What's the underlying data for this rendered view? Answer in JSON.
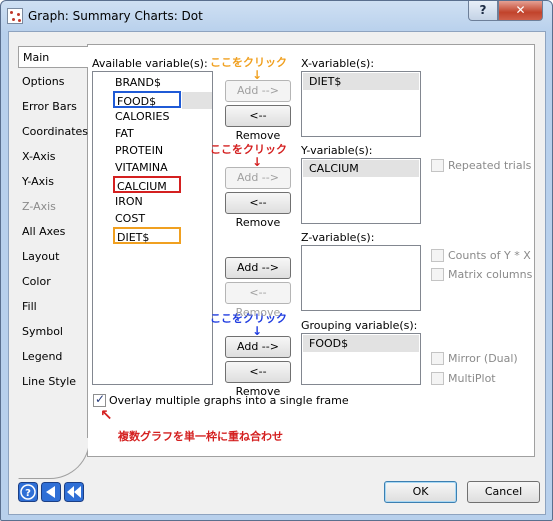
{
  "window": {
    "title": "Graph: Summary Charts: Dot",
    "help_label": "?",
    "close_label": "✕"
  },
  "tabs": [
    {
      "label": "Main",
      "state": "active"
    },
    {
      "label": "Options",
      "state": "normal"
    },
    {
      "label": "Error Bars",
      "state": "normal"
    },
    {
      "label": "Coordinates",
      "state": "normal"
    },
    {
      "label": "X-Axis",
      "state": "normal"
    },
    {
      "label": "Y-Axis",
      "state": "normal"
    },
    {
      "label": "Z-Axis",
      "state": "disabled"
    },
    {
      "label": "All Axes",
      "state": "normal"
    },
    {
      "label": "Layout",
      "state": "normal"
    },
    {
      "label": "Color",
      "state": "normal"
    },
    {
      "label": "Fill",
      "state": "normal"
    },
    {
      "label": "Symbol",
      "state": "normal"
    },
    {
      "label": "Legend",
      "state": "normal"
    },
    {
      "label": "Line Style",
      "state": "normal"
    }
  ],
  "available": {
    "label": "Available variable(s):",
    "items": [
      "BRAND$",
      "FOOD$",
      "CALORIES",
      "FAT",
      "PROTEIN",
      "VITAMINA",
      "CALCIUM",
      "IRON",
      "COST",
      "DIET$"
    ]
  },
  "x_variable": {
    "label": "X-variable(s):",
    "items": [
      "DIET$"
    ]
  },
  "y_variable": {
    "label": "Y-variable(s):",
    "items": [
      "CALCIUM"
    ]
  },
  "z_variable": {
    "label": "Z-variable(s):",
    "items": []
  },
  "grouping_variable": {
    "label": "Grouping variable(s):",
    "items": [
      "FOOD$"
    ]
  },
  "buttons": {
    "add": "Add -->",
    "remove": "<-- Remove",
    "ok": "OK",
    "cancel": "Cancel"
  },
  "options": {
    "repeated_trials": "Repeated trials",
    "counts": "Counts of Y * X",
    "matrix_columns": "Matrix columns",
    "mirror": "Mirror (Dual)",
    "multiplot": "MultiPlot",
    "overlay": "Overlay multiple graphs into a single frame",
    "overlay_checked": true
  },
  "annotations": {
    "click_here_x": "ここをクリック",
    "click_here_y": "ここをクリック",
    "click_here_group": "ここをクリック",
    "overlay_note": "複数グラフを単一枠に重ね合わせ",
    "down_arrow": "↓",
    "up_arrow": "↖"
  },
  "colors": {
    "orange": "#f0a020",
    "red": "#d42020",
    "blue": "#1f3ce0"
  },
  "icons": {
    "help": "help-icon",
    "back": "back-icon",
    "first": "first-icon"
  }
}
